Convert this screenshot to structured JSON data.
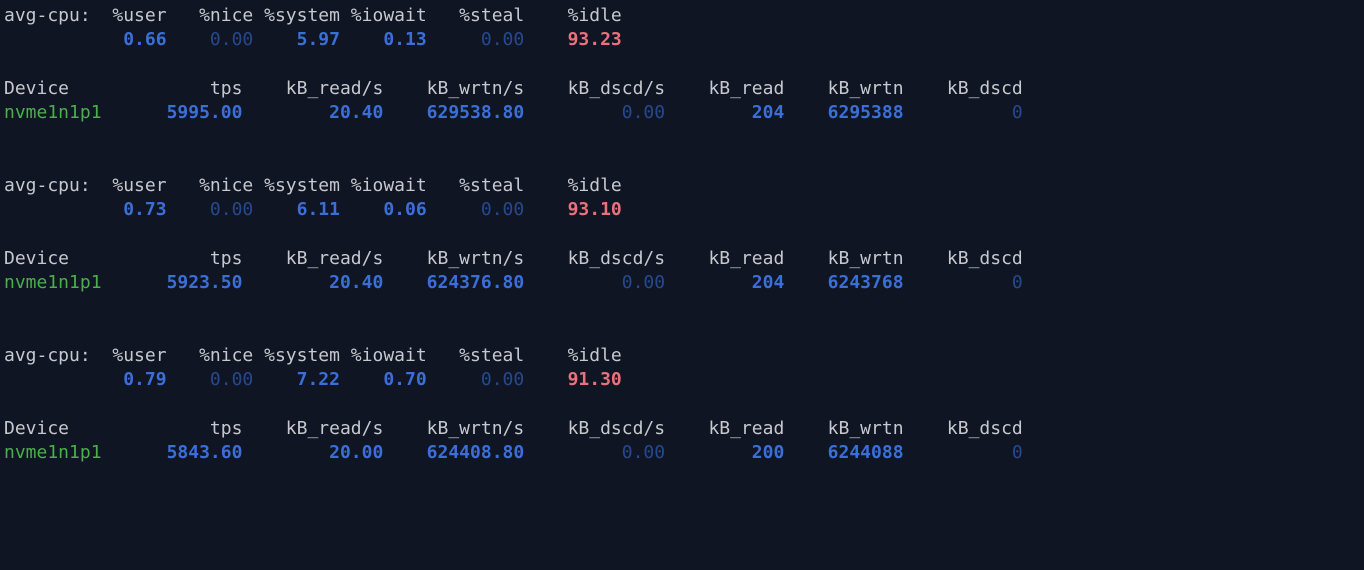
{
  "labels": {
    "avg_cpu_prefix": "avg-cpu:",
    "cpu_cols": [
      "%user",
      "%nice",
      "%system",
      "%iowait",
      "%steal",
      "%idle"
    ],
    "device_header": "Device",
    "dev_cols": [
      "tps",
      "kB_read/s",
      "kB_wrtn/s",
      "kB_dscd/s",
      "kB_read",
      "kB_wrtn",
      "kB_dscd"
    ]
  },
  "samples": [
    {
      "cpu": {
        "user": "0.66",
        "nice": "0.00",
        "system": "5.97",
        "iowait": "0.13",
        "steal": "0.00",
        "idle": "93.23"
      },
      "device": {
        "name": "nvme1n1p1",
        "tps": "5995.00",
        "kb_read_s": "20.40",
        "kb_wrtn_s": "629538.80",
        "kb_dscd_s": "0.00",
        "kb_read": "204",
        "kb_wrtn": "6295388",
        "kb_dscd": "0"
      }
    },
    {
      "cpu": {
        "user": "0.73",
        "nice": "0.00",
        "system": "6.11",
        "iowait": "0.06",
        "steal": "0.00",
        "idle": "93.10"
      },
      "device": {
        "name": "nvme1n1p1",
        "tps": "5923.50",
        "kb_read_s": "20.40",
        "kb_wrtn_s": "624376.80",
        "kb_dscd_s": "0.00",
        "kb_read": "204",
        "kb_wrtn": "6243768",
        "kb_dscd": "0"
      }
    },
    {
      "cpu": {
        "user": "0.79",
        "nice": "0.00",
        "system": "7.22",
        "iowait": "0.70",
        "steal": "0.00",
        "idle": "91.30"
      },
      "device": {
        "name": "nvme1n1p1",
        "tps": "5843.60",
        "kb_read_s": "20.00",
        "kb_wrtn_s": "624408.80",
        "kb_dscd_s": "0.00",
        "kb_read": "200",
        "kb_wrtn": "6244088",
        "kb_dscd": "0"
      }
    }
  ]
}
